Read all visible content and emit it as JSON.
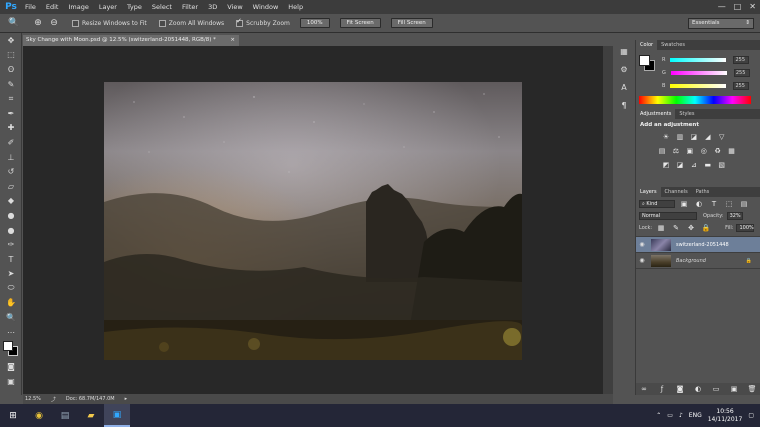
{
  "app": {
    "logo": "Ps"
  },
  "menu": [
    "File",
    "Edit",
    "Image",
    "Layer",
    "Type",
    "Select",
    "Filter",
    "3D",
    "View",
    "Window",
    "Help"
  ],
  "window_controls": [
    "—",
    "□",
    "✕"
  ],
  "options": {
    "resize_windows_label": "Resize Windows to Fit",
    "zoom_all_label": "Zoom All Windows",
    "scrubby_zoom_label": "Scrubby Zoom",
    "btn_100": "100%",
    "btn_fit": "Fit Screen",
    "btn_fill": "Fill Screen",
    "workspace": "Essentials"
  },
  "document": {
    "tab_title": "Sky Change with Moon.psd @ 12.5% (switzerland-2051448, RGB/8) *",
    "zoom": "12.5%",
    "doc_size": "Doc: 68.7M/147.0M"
  },
  "color_panel": {
    "tabs": [
      "Color",
      "Swatches"
    ],
    "channels": [
      {
        "label": "R",
        "value": "255",
        "gradient": "#ff4040"
      },
      {
        "label": "G",
        "value": "255",
        "gradient": "#ff40ff"
      },
      {
        "label": "B",
        "value": "255",
        "gradient": "#ffff40"
      }
    ]
  },
  "adjustments_panel": {
    "tabs": [
      "Adjustments",
      "Styles"
    ],
    "heading": "Add an adjustment",
    "row1": [
      "☀",
      "▥",
      "◪",
      "◢",
      "▽"
    ],
    "row2": [
      "▤",
      "⚖",
      "▣",
      "◎",
      "♻",
      "▦"
    ],
    "row3": [
      "◩",
      "◪",
      "⊿",
      "▬",
      "▧"
    ]
  },
  "layers_panel": {
    "tabs": [
      "Layers",
      "Channels",
      "Paths"
    ],
    "kind_label": "Kind",
    "blend_mode": "Normal",
    "opacity_label": "Opacity:",
    "opacity_value": "32%",
    "lock_label": "Lock:",
    "fill_label": "Fill:",
    "fill_value": "100%",
    "layers": [
      {
        "name": "switzerland-2051448",
        "selected": true
      },
      {
        "name": "Background",
        "selected": false
      }
    ]
  },
  "taskbar": {
    "language": "ENG",
    "time": "10:56",
    "date": "14/11/2017"
  }
}
